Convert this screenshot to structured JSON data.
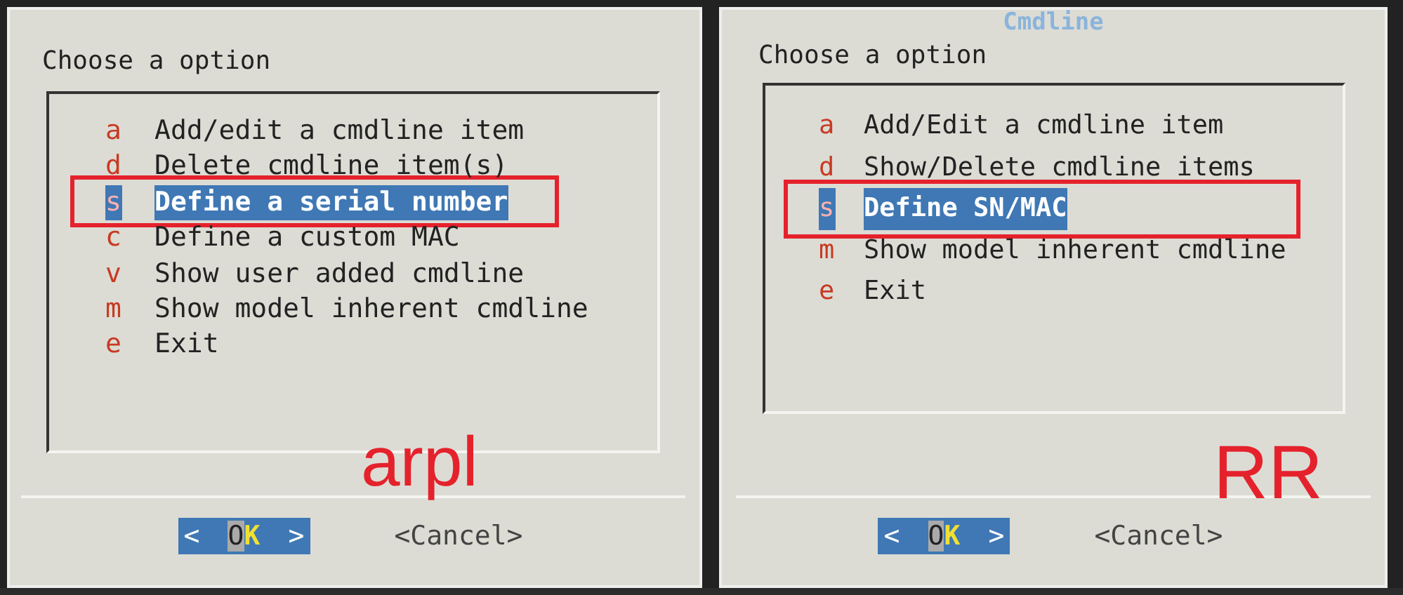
{
  "panels": [
    {
      "prompt": "Choose a option",
      "items": [
        {
          "key": "a",
          "label": "Add/edit a cmdline item",
          "selected": false
        },
        {
          "key": "d",
          "label": "Delete cmdline item(s)",
          "selected": false
        },
        {
          "key": "s",
          "label": "Define a serial number",
          "selected": true
        },
        {
          "key": "c",
          "label": "Define a custom MAC",
          "selected": false
        },
        {
          "key": "v",
          "label": "Show user added cmdline",
          "selected": false
        },
        {
          "key": "m",
          "label": "Show model inherent cmdline",
          "selected": false
        },
        {
          "key": "e",
          "label": "Exit",
          "selected": false
        }
      ],
      "buttons": [
        {
          "kind": "ok",
          "open": "<",
          "label": "OK",
          "close": ">",
          "selected": true
        },
        {
          "kind": "cancel",
          "label": "<Cancel>",
          "selected": false
        }
      ],
      "annotation": "arpl"
    },
    {
      "title": "Cmdline",
      "prompt": "Choose a option",
      "items": [
        {
          "key": "a",
          "label": "Add/Edit a cmdline item",
          "selected": false
        },
        {
          "key": "d",
          "label": "Show/Delete cmdline items",
          "selected": false
        },
        {
          "key": "s",
          "label": "Define SN/MAC",
          "selected": true
        },
        {
          "key": "m",
          "label": "Show model inherent cmdline",
          "selected": false
        },
        {
          "key": "e",
          "label": "Exit",
          "selected": false
        }
      ],
      "buttons": [
        {
          "kind": "ok",
          "open": "<",
          "label": "OK",
          "close": ">",
          "selected": true
        },
        {
          "kind": "cancel",
          "label": "<Cancel>",
          "selected": false
        }
      ],
      "annotation": "RR"
    }
  ]
}
